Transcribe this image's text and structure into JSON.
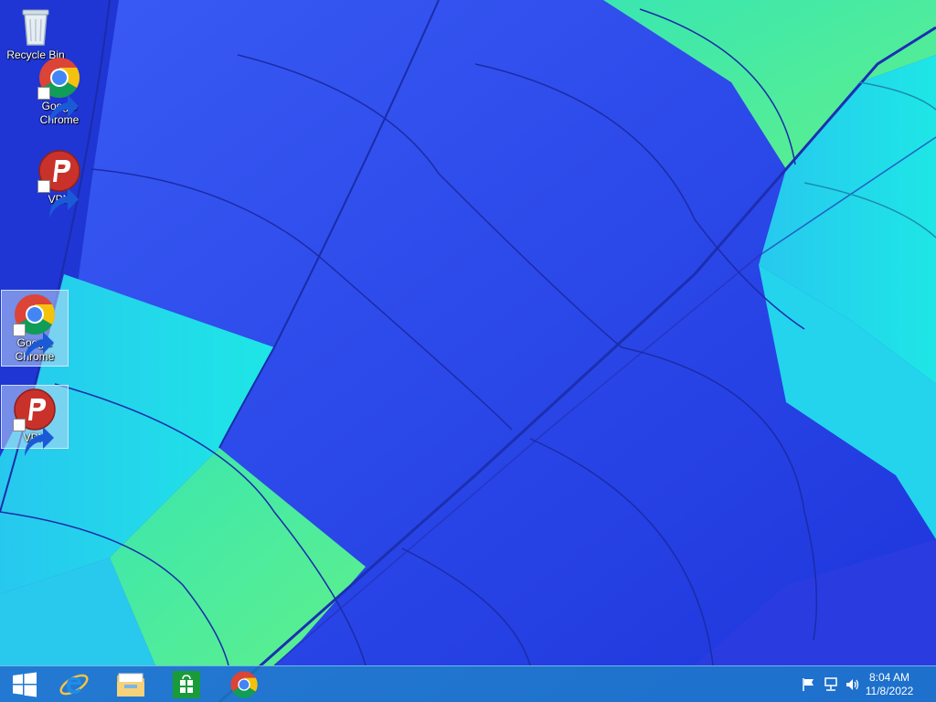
{
  "desktop": {
    "icons": [
      {
        "label": "Recycle Bin",
        "icon": "recycle-bin-icon"
      },
      {
        "label": "Google Chrome",
        "icon": "chrome-icon"
      },
      {
        "label": "VPN",
        "icon": "psiphon-vpn-icon"
      },
      {
        "label": "Google Chrome",
        "icon": "chrome-icon",
        "selected": true
      },
      {
        "label": "VPN",
        "icon": "psiphon-vpn-icon",
        "selected": true
      }
    ]
  },
  "taskbar": {
    "pinned": [
      {
        "name": "start",
        "icon": "windows-logo-icon"
      },
      {
        "name": "internet-explorer",
        "icon": "internet-explorer-icon"
      },
      {
        "name": "file-explorer",
        "icon": "folder-icon"
      },
      {
        "name": "store",
        "icon": "store-icon"
      },
      {
        "name": "chrome",
        "icon": "chrome-icon"
      }
    ],
    "tray": {
      "icons": [
        "action-center-flag-icon",
        "network-icon",
        "volume-icon"
      ],
      "time": "8:04 AM",
      "date": "11/8/2022"
    }
  },
  "colors": {
    "wallpaper_blue": "#2e4ff0",
    "wallpaper_cyan": "#1fd6e6",
    "wallpaper_green": "#43ee9a",
    "chrome_red": "#db4437",
    "chrome_yellow": "#f4c20d",
    "chrome_green": "#0f9d58",
    "chrome_blue": "#4285f4",
    "vpn_red": "#c8322a"
  }
}
